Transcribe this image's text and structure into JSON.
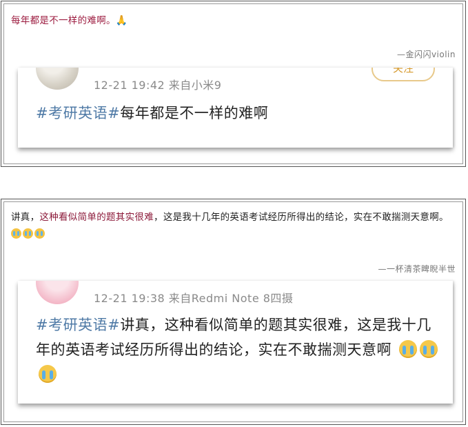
{
  "post1": {
    "caption": "每年都是不一样的难啊。",
    "caption_emoji": "pray-emoji",
    "attribution": "—金闪闪violin",
    "screenshot": {
      "follow_label": "关注",
      "meta": "12-21 19:42  来自小米9",
      "hashtag": "#考研英语#",
      "text": "每年都是不一样的难啊"
    }
  },
  "post2": {
    "caption_before": "讲真，",
    "caption_highlight": "这种看似简单的题其实很难",
    "caption_after": "，这是我十几年的英语考试经历所得出的结论，实在不敢揣测天意啊。",
    "caption_emoji": "crying-face-emoji",
    "attribution": "—一杯清茶睥睨半世",
    "screenshot": {
      "meta": "12-21 19:38  来自Redmi Note 8四摄",
      "hashtag": "#考研英语#",
      "text": "讲真，这种看似简单的题其实很难，这是我十几年的英语考试经历所得出的结论，实在不敢揣测天意啊",
      "emoji": "crying-face-emoji"
    }
  },
  "colors": {
    "caption_accent": "#9c1b3f",
    "hashtag": "#4f7aa6",
    "meta": "#8a8a8a"
  }
}
